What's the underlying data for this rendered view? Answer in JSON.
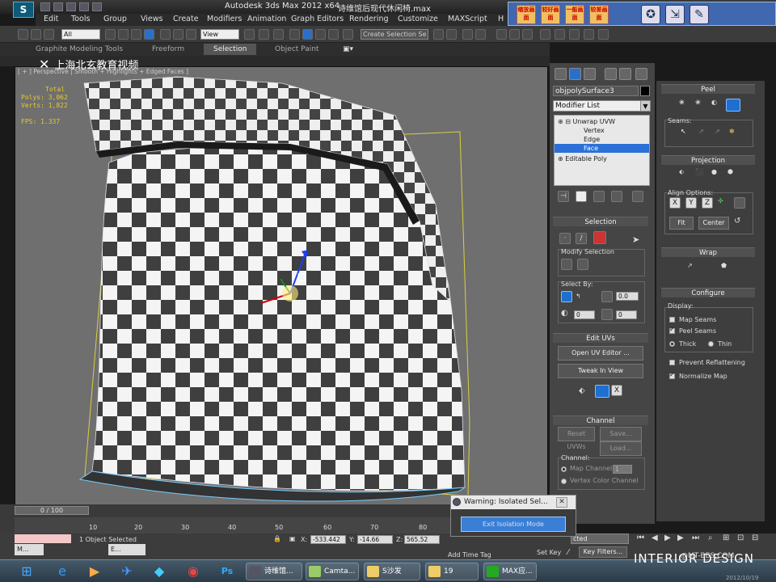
{
  "titlebar": {
    "app_title": "Autodesk 3ds Max  2012 x64",
    "file_name": "诗维馆后现代休闲椅.max"
  },
  "menu": [
    "Edit",
    "Tools",
    "Group",
    "Views",
    "Create",
    "Modifiers",
    "Animation",
    "Graph Editors",
    "Rendering",
    "Customize",
    "MAXScript",
    "H"
  ],
  "ad_panel": {
    "buttons": [
      "缩放画面",
      "较好画面",
      "一般画面",
      "较差画面"
    ]
  },
  "toolbar": {
    "filter": "All",
    "refcoord": "View",
    "selset": "Create Selection Se"
  },
  "ribbon": {
    "tabs": [
      "Graphite Modeling Tools",
      "Freeform",
      "Selection",
      "Object Paint"
    ],
    "active": "Selection"
  },
  "viewport": {
    "label": "[ + ] Perspective | Smooth + Highlights + Edged Faces ]",
    "overlay_text": "上海北玄教育视频",
    "stats": {
      "total": "Total",
      "polys_label": "Polys:",
      "polys": "3,062",
      "verts_label": "Verts:",
      "verts": "1,822",
      "fps_label": "FPS:",
      "fps": "1.337"
    }
  },
  "command_panel": {
    "object_name": "objpolySurface3",
    "modifier_list": "Modifier List",
    "stack": [
      "Unwrap UVW",
      "Vertex",
      "Edge",
      "Face",
      "Editable Poly"
    ],
    "stack_selected": "Face",
    "selection_title": "Selection",
    "modify_selection": "Modify Selection",
    "select_by": "Select By:",
    "spin_val1": "0.0",
    "spin_val2": "0",
    "spin_val3": "0",
    "edit_uvs_title": "Edit UVs",
    "open_uv_editor": "Open UV Editor ...",
    "tweak_in_view": "Tweak In View",
    "channel_title": "Channel",
    "reset_uvws": "Reset UVWs",
    "save": "Save...",
    "load": "Load...",
    "channel_label": "Channel:",
    "map_channel": "Map Channel:",
    "map_channel_val": "1",
    "vertex_color": "Vertex Color Channel"
  },
  "uv_panel": {
    "peel_title": "Peel",
    "seams": "Seams:",
    "projection_title": "Projection",
    "align_options": "Align Options:",
    "align_buttons": [
      "X",
      "Y",
      "Z"
    ],
    "fit": "Fit",
    "center": "Center",
    "wrap_title": "Wrap",
    "configure_title": "Configure",
    "display": "Display:",
    "map_seams": "Map Seams",
    "peel_seams": "Peel Seams",
    "thick": "Thick",
    "thin": "Thin",
    "prevent_reflattening": "Prevent Reflattening",
    "normalize_map": "Normalize Map"
  },
  "timeline": {
    "frame": "0 / 100",
    "ticks": [
      "10",
      "20",
      "30",
      "40",
      "50",
      "60",
      "70",
      "80"
    ]
  },
  "status": {
    "selected": "1 Object Selected",
    "x_label": "X:",
    "x": "-533.442",
    "y_label": "Y:",
    "y": "-14.66",
    "z_label": "Z:",
    "z": "565.52",
    "add_time_tag": "Add Time Tag",
    "set_key": "Set Key",
    "key_filters": "Key Filters...",
    "selected_dd": "cted"
  },
  "warning": {
    "title": "Warning: Isolated Sel...",
    "button": "Exit Isolation Mode"
  },
  "taskbar": {
    "items": [
      "M...",
      "E...",
      "诗维馆...",
      "Camta...",
      "S沙发",
      "19",
      "MAX应..."
    ]
  },
  "watermark": {
    "text": "INTERIOR DESIGN",
    "site": "@MT-BBS.COM",
    "date": "2012/10/19"
  },
  "colors": {
    "accent": "#1d6fd0",
    "viewport_bg": "#6f6f6f",
    "stats": "#e8c830"
  }
}
